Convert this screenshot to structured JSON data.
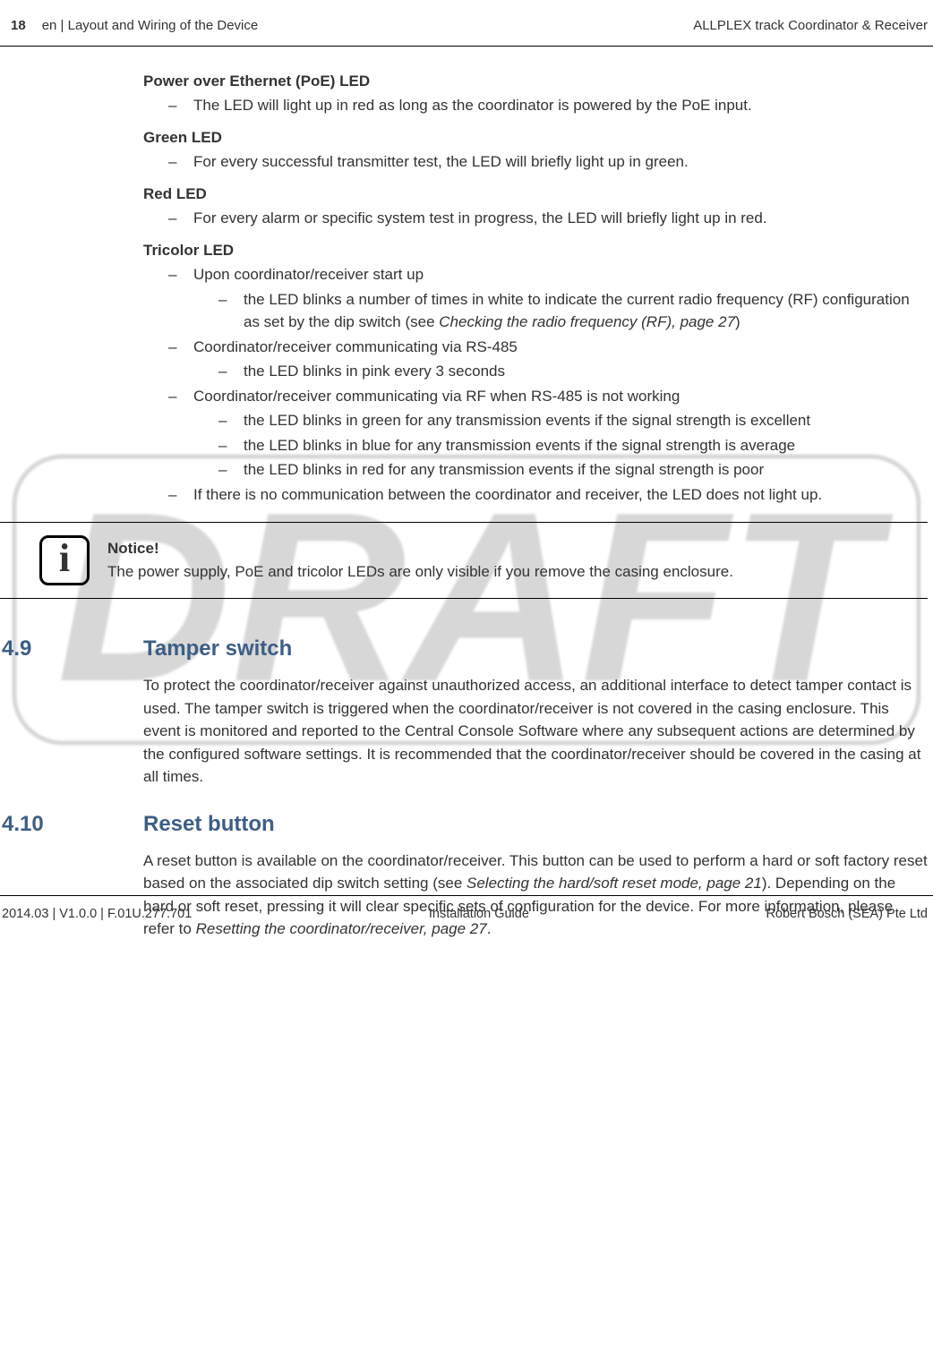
{
  "header": {
    "page_number": "18",
    "breadcrumb": "en | Layout and Wiring of the Device",
    "product": "ALLPLEX track Coordinator & Receiver"
  },
  "watermark": "DRAFT",
  "leds": {
    "poe": {
      "title": "Power over Ethernet (PoE) LED",
      "item1": "The LED will light up in red as long as the coordinator is powered by the PoE input."
    },
    "green": {
      "title": "Green LED",
      "item1": "For every successful transmitter test, the LED will briefly light up in green."
    },
    "red": {
      "title": "Red LED",
      "item1": "For every alarm or specific system test in progress, the LED will briefly light up in red."
    },
    "tricolor": {
      "title": "Tricolor LED",
      "startup": {
        "label": "Upon coordinator/receiver start up",
        "sub1_a": "the LED blinks a number of times in white to indicate the current radio frequency (RF) configuration as set by the dip switch (see ",
        "sub1_ref": "Checking the radio frequency (RF), page 27",
        "sub1_b": ")"
      },
      "rs485": {
        "label": "Coordinator/receiver communicating via RS-485",
        "sub1": "the LED blinks in pink every 3 seconds"
      },
      "rf": {
        "label": "Coordinator/receiver communicating via RF when RS-485 is not working",
        "sub1": "the LED blinks in green for any transmission events if the signal strength is excellent",
        "sub2": "the LED blinks in blue for any transmission events if the signal strength is average",
        "sub3": "the LED blinks in red for any transmission events if the signal strength is poor"
      },
      "nocomm": "If there is no communication between the coordinator and receiver, the LED does not light up."
    }
  },
  "notice": {
    "title": "Notice!",
    "body": "The power supply, PoE and tricolor LEDs are only visible if you remove the casing enclosure."
  },
  "sections": {
    "s49": {
      "num": "4.9",
      "title": "Tamper switch",
      "body": "To protect the coordinator/receiver against unauthorized access, an additional interface to detect tamper contact is used. The tamper switch is triggered when the coordinator/receiver is not covered in the casing enclosure. This event is monitored and reported to the Central Console Software where any subsequent actions are determined by the configured software settings. It is recommended that the coordinator/receiver should be covered in the casing at all times."
    },
    "s410": {
      "num": "4.10",
      "title": "Reset button",
      "body_a": "A reset button is available on the coordinator/receiver. This button can be used to perform a hard or soft factory reset based on the associated dip switch setting (see ",
      "ref1": "Selecting the hard/soft reset mode, page 21",
      "body_b": "). Depending on the hard or soft reset, pressing it will clear specific sets of configuration for the device. For more information, please refer to ",
      "ref2": "Resetting the coordinator/receiver, page 27",
      "body_c": "."
    }
  },
  "footer": {
    "left": "2014.03 | V1.0.0 | F.01U.277.701",
    "center": "Installation Guide",
    "right": "Robert Bosch (SEA) Pte Ltd"
  }
}
